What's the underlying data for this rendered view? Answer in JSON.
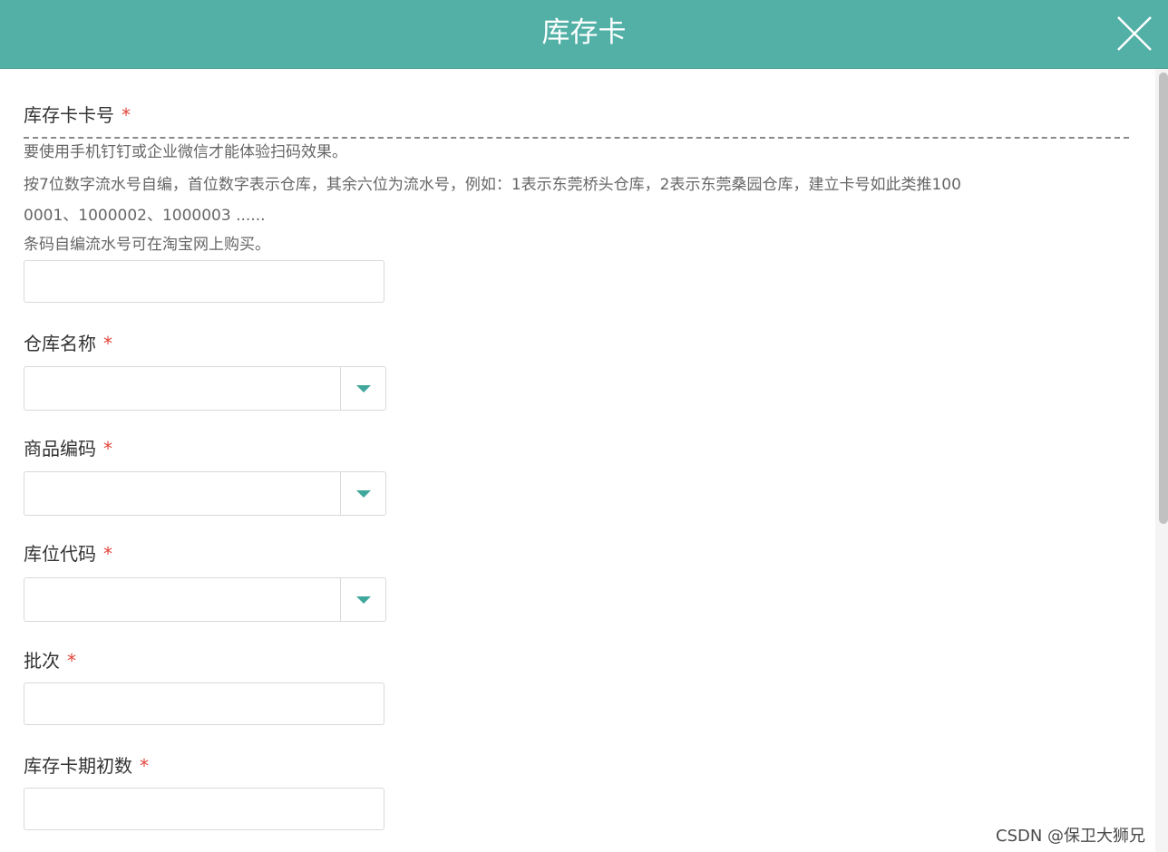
{
  "dialog": {
    "title": "库存卡"
  },
  "form": {
    "card_no": {
      "label": "库存卡卡号",
      "required_mark": "*",
      "help_lines": [
        "要使用手机钉钉或企业微信才能体验扫码效果。",
        "按7位数字流水号自编，首位数字表示仓库，其余六位为流水号，例如：1表示东莞桥头仓库，2表示东莞桑园仓库，建立卡号如此类推100",
        "0001、1000002、1000003 ......",
        "条码自编流水号可在淘宝网上购买。"
      ],
      "value": ""
    },
    "warehouse": {
      "label": "仓库名称",
      "required_mark": "*",
      "value": ""
    },
    "product_code": {
      "label": "商品编码",
      "required_mark": "*",
      "value": ""
    },
    "location_code": {
      "label": "库位代码",
      "required_mark": "*",
      "value": ""
    },
    "batch": {
      "label": "批次",
      "required_mark": "*",
      "value": ""
    },
    "initial_qty": {
      "label": "库存卡期初数",
      "required_mark": "*",
      "value": ""
    }
  },
  "watermark": "CSDN @保卫大狮兄",
  "colors": {
    "header": "#52b0a6",
    "accent": "#3fa79c",
    "required": "#e0453a"
  },
  "icons": {
    "close": "close-icon",
    "dropdown": "chevron-down-icon"
  }
}
